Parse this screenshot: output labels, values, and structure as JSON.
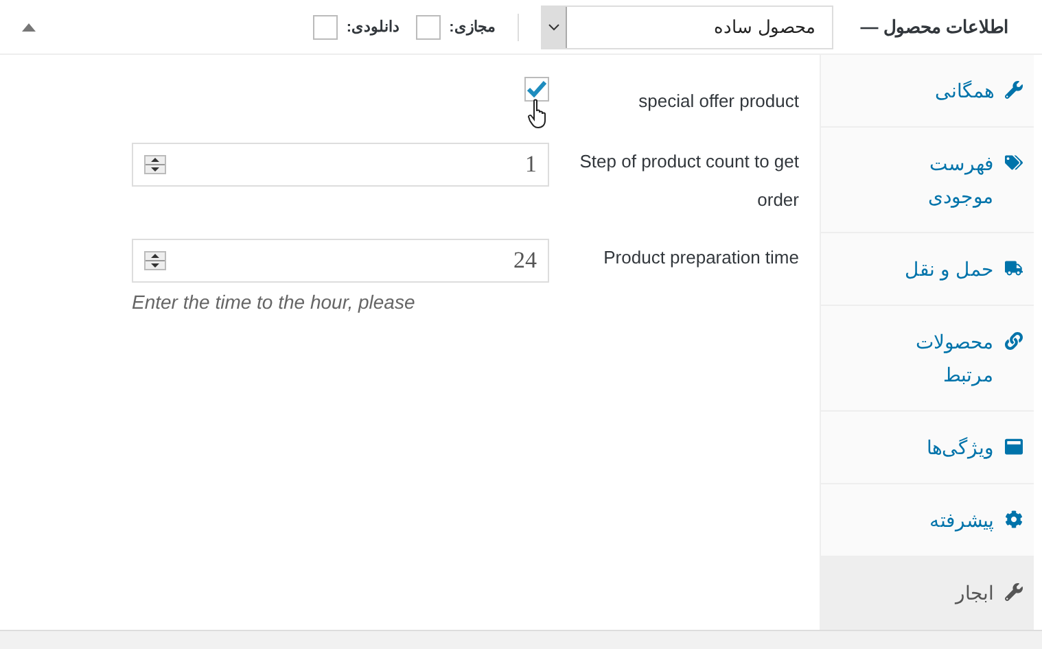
{
  "header": {
    "title": "اطلاعات محصول —",
    "product_type": {
      "value": "محصول ساده"
    },
    "options": [
      {
        "label": "مجازی:",
        "checked": false
      },
      {
        "label": "دانلودی:",
        "checked": false
      }
    ],
    "expanded": true
  },
  "sidebar": {
    "items": [
      {
        "label": "همگانی",
        "selected": false
      },
      {
        "label": "فهرست موجودی",
        "selected": false
      },
      {
        "label": "حمل و نقل",
        "selected": false
      },
      {
        "label": "محصولات مرتبط",
        "selected": false
      },
      {
        "label": "ویژگی‌ها",
        "selected": false
      },
      {
        "label": "پیشرفته",
        "selected": false
      },
      {
        "label": "ابجار",
        "selected": true
      }
    ]
  },
  "fields": [
    {
      "kind": "checkbox",
      "label": "special offer product",
      "checked": true
    },
    {
      "kind": "number",
      "label": "Step of product count to get order",
      "value": "1"
    },
    {
      "kind": "number",
      "label": "Product preparation time",
      "value": "24",
      "description": "Enter the time to the hour, please"
    }
  ]
}
